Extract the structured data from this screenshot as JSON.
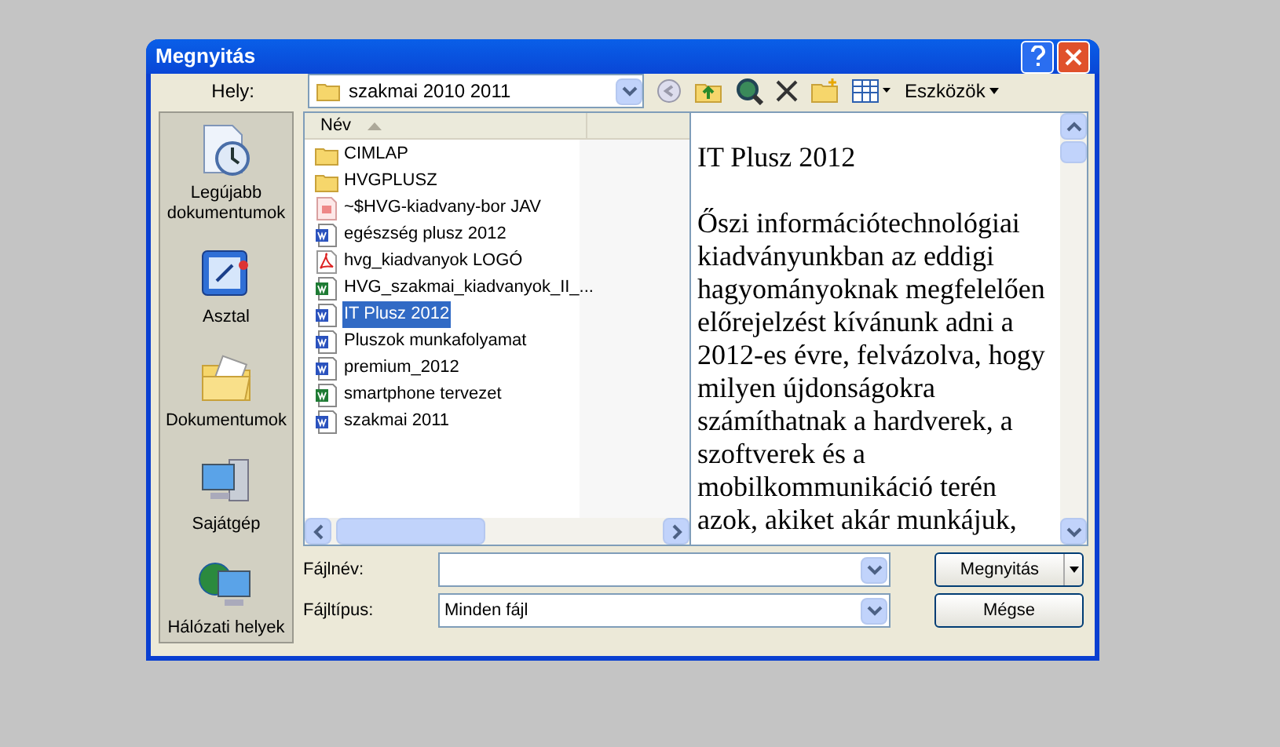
{
  "window": {
    "title": "Megnyitás"
  },
  "toolbar": {
    "location_label": "Hely:",
    "location": "szakmai 2010 2011",
    "tools_label": "Eszközök"
  },
  "places": [
    {
      "label": "Legújabb dokumentumok",
      "kind": "recent"
    },
    {
      "label": "Asztal",
      "kind": "desktop"
    },
    {
      "label": "Dokumentumok",
      "kind": "documents"
    },
    {
      "label": "Sajátgép",
      "kind": "computer"
    },
    {
      "label": "Hálózati helyek",
      "kind": "network"
    }
  ],
  "file_list": {
    "columns": [
      "Név"
    ],
    "files": [
      {
        "name": "CIMLAP",
        "kind": "folder",
        "selected": false
      },
      {
        "name": "HVGPLUSZ",
        "kind": "folder",
        "selected": false
      },
      {
        "name": "~$HVG-kiadvany-bor JAV",
        "kind": "temp",
        "selected": false
      },
      {
        "name": "egészség plusz 2012",
        "kind": "word",
        "selected": false
      },
      {
        "name": "hvg_kiadvanyok LOGÓ",
        "kind": "pdf",
        "selected": false
      },
      {
        "name": "HVG_szakmai_kiadvanyok_II_...",
        "kind": "excel",
        "selected": false
      },
      {
        "name": "IT Plusz 2012",
        "kind": "word",
        "selected": true
      },
      {
        "name": "Pluszok munkafolyamat",
        "kind": "word",
        "selected": false
      },
      {
        "name": "premium_2012",
        "kind": "word",
        "selected": false
      },
      {
        "name": "smartphone tervezet",
        "kind": "excel",
        "selected": false
      },
      {
        "name": "szakmai 2011",
        "kind": "word",
        "selected": false
      }
    ]
  },
  "preview": {
    "title": "IT Plusz 2012",
    "text": "Őszi információtechnológiai kiadványunkban az eddigi hagyományoknak megfelelően előrejelzést kívánunk adni a 2012-es évre, felvázolva, hogy milyen újdonságokra számíthatnak a hardverek, a szoftverek és a mobilkommunikáció terén azok, akiket akár munkájuk,"
  },
  "file_name": {
    "label": "Fájlnév:"
  },
  "file_type": {
    "label": "Fájltípus:",
    "value": "Minden fájl"
  },
  "buttons": [
    "Megnyitás",
    "Mégse"
  ]
}
